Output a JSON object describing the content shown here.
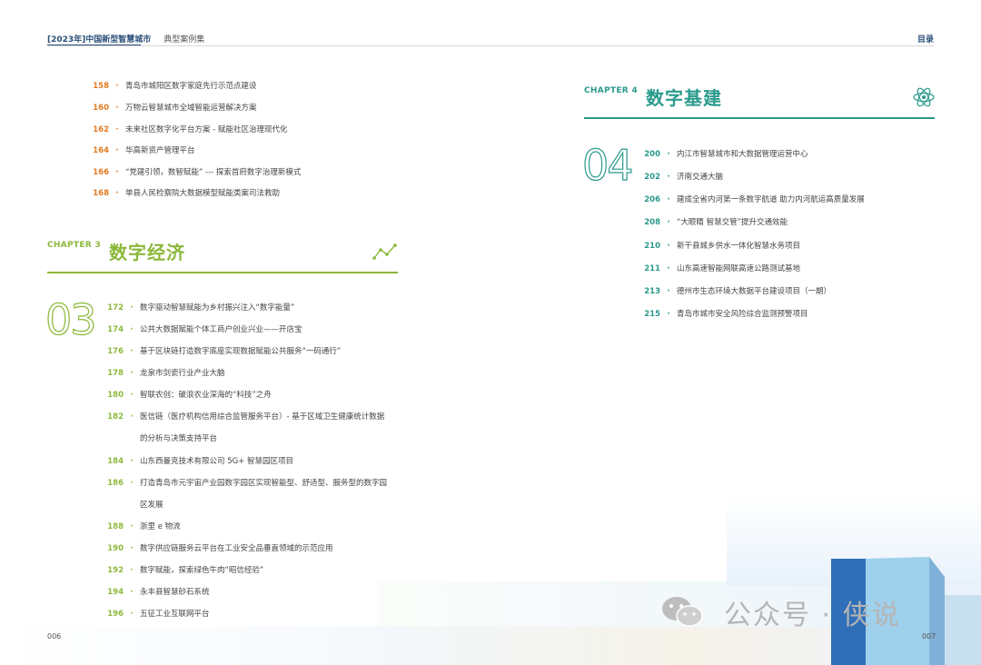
{
  "header": {
    "book_title": "[2023年]中国新型智慧城市",
    "section": "典型案例集",
    "right_link": "目录"
  },
  "chapter2_tail": [
    {
      "page": "158",
      "text": "青岛市城阳区数字家庭先行示范点建设"
    },
    {
      "page": "160",
      "text": "万物云智慧城市全域智能运营解决方案"
    },
    {
      "page": "162",
      "text": "未来社区数字化平台方案 - 赋能社区治理现代化"
    },
    {
      "page": "164",
      "text": "华高新资产管理平台"
    },
    {
      "page": "166",
      "text": "“党建引领，数智赋能” --- 探索首府数字治理新模式"
    },
    {
      "page": "168",
      "text": "单县人民检察院大数据模型赋能类案司法救助"
    }
  ],
  "chapter3": {
    "label": "CHAPTER 3",
    "title": "数字经济",
    "number": "03",
    "icon": "line-chart-icon",
    "color": "#8cb83a",
    "entries": [
      {
        "page": "172",
        "text": "数字驱动智慧赋能为乡村振兴注入“数字能量”"
      },
      {
        "page": "174",
        "text": "公共大数据赋能个体工商户创业兴业——开店宝"
      },
      {
        "page": "176",
        "text": "基于区块链打造数字底座实现数据赋能公共服务“一码通行”"
      },
      {
        "page": "178",
        "text": "龙泉市剑瓷行业产业大脑"
      },
      {
        "page": "180",
        "text": "智联农创：破浪农业深海的“科技”之舟"
      },
      {
        "page": "182",
        "text": "医信链（医疗机构信用综合监管服务平台）- 基于区域卫生健康统计数据"
      },
      {
        "page": "",
        "text": "的分析与决策支持平台"
      },
      {
        "page": "184",
        "text": "山东西曼克技术有限公司 5G+ 智慧园区项目"
      },
      {
        "page": "186",
        "text": "打造青岛市元宇宙产业园数字园区实现智能型、舒适型、服务型的数字园"
      },
      {
        "page": "",
        "text": "区发展"
      },
      {
        "page": "188",
        "text": "浙里 e 物流"
      },
      {
        "page": "190",
        "text": "数字供应链服务云平台在工业安全品垂直领域的示范应用"
      },
      {
        "page": "192",
        "text": "数字赋能，探索绿色牛肉“昭信经验”"
      },
      {
        "page": "194",
        "text": "永丰县智慧砂石系统"
      },
      {
        "page": "196",
        "text": "五征工业互联网平台"
      }
    ]
  },
  "chapter4": {
    "label": "CHAPTER 4",
    "title": "数字基建",
    "number": "04",
    "icon": "atom-icon",
    "color": "#2a9a8c",
    "entries": [
      {
        "page": "200",
        "text": "内江市智慧城市和大数据管理运营中心"
      },
      {
        "page": "202",
        "text": "济南交通大脑"
      },
      {
        "page": "206",
        "text": "建成全省内河第一条数字航道 助力内河航运高质量发展"
      },
      {
        "page": "208",
        "text": "“大眼睛 智慧交管”提升交通效能"
      },
      {
        "page": "210",
        "text": "新干县城乡供水一体化智慧水务项目"
      },
      {
        "page": "211",
        "text": "山东高速智能网联高速公路测试基地"
      },
      {
        "page": "213",
        "text": "德州市生态环境大数据平台建设项目（一期）"
      },
      {
        "page": "215",
        "text": "青岛市城市安全风险综合监测预警项目"
      }
    ]
  },
  "footer": {
    "left_page": "006",
    "right_page": "007"
  },
  "watermark": {
    "icon": "wechat-icon",
    "text": "公众号 · 侠说"
  },
  "colors": {
    "navy": "#2b4f7a",
    "orange": "#e07a1f",
    "green": "#8cb83a",
    "teal": "#2a9a8c"
  }
}
